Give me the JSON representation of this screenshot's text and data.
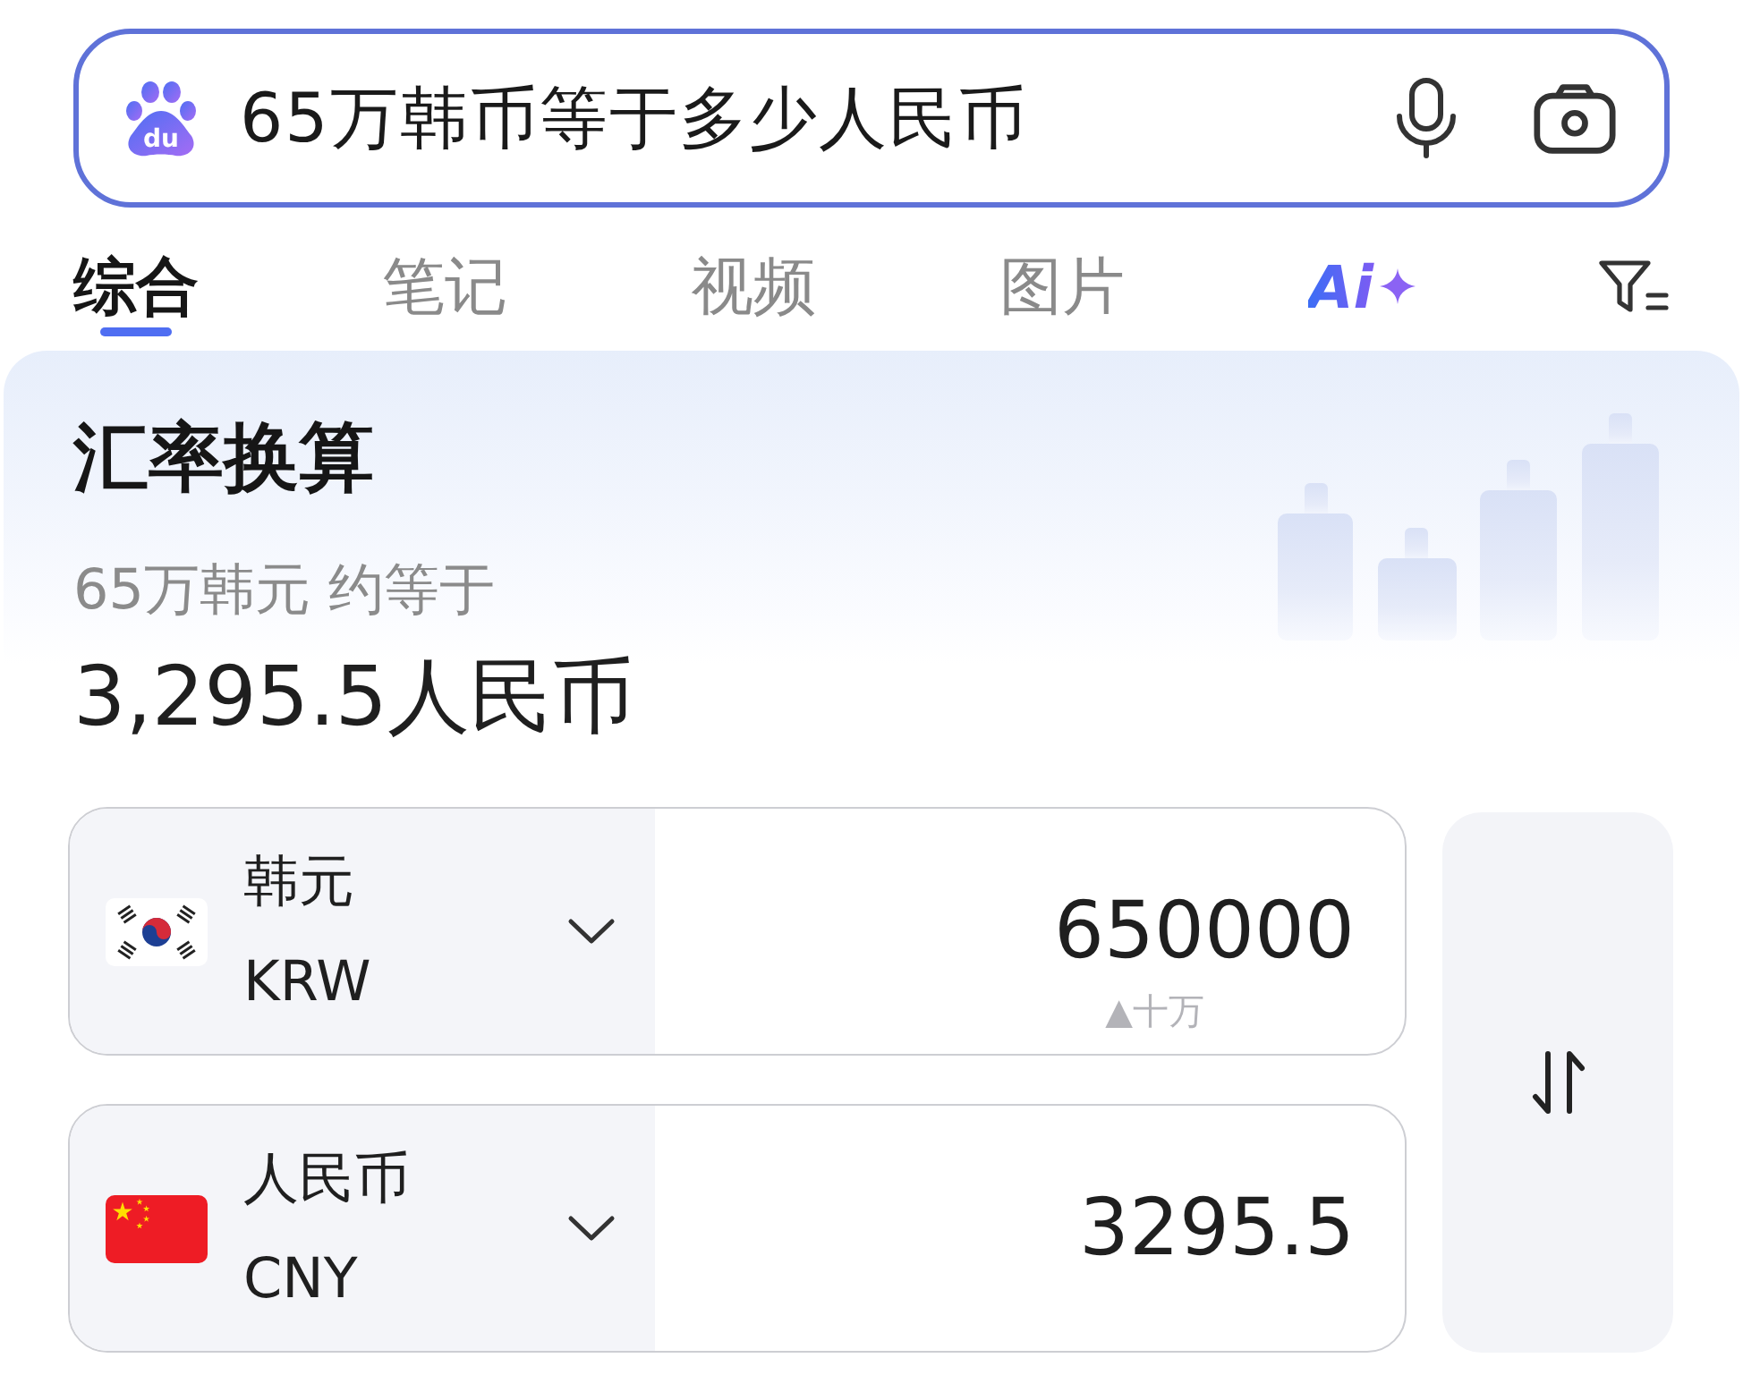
{
  "search": {
    "logo_text": "du",
    "query": "65万韩币等于多少人民币"
  },
  "tabs": [
    {
      "kind": "text",
      "label": "综合",
      "selected": true
    },
    {
      "kind": "text",
      "label": "笔记",
      "selected": false
    },
    {
      "kind": "text",
      "label": "视频",
      "selected": false
    },
    {
      "kind": "text",
      "label": "图片",
      "selected": false
    },
    {
      "kind": "ai",
      "label": "Ai",
      "selected": false
    }
  ],
  "card": {
    "title": "汇率换算",
    "subtitle": "65万韩元 约等于",
    "result": "3,295.5人民币"
  },
  "converter": [
    {
      "kind": "korea",
      "currency": "韩元",
      "code": "KRW",
      "amount": "650000",
      "hint": "▲十万"
    },
    {
      "kind": "china",
      "currency": "人民币",
      "code": "CNY",
      "amount": "3295.5"
    }
  ]
}
